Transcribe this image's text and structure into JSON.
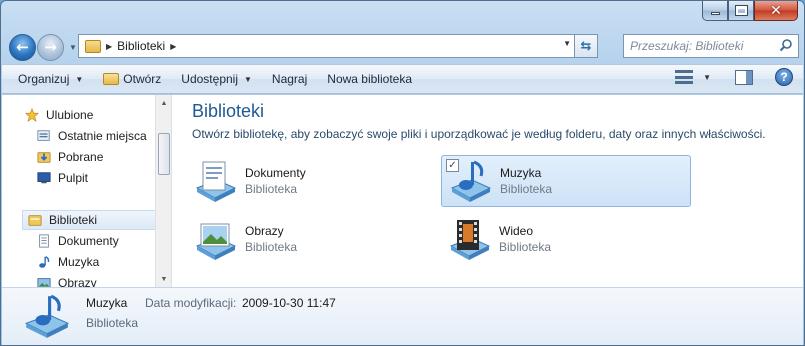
{
  "window": {
    "controls": {
      "minimize": "minimize",
      "maximize": "maximize",
      "close": "close"
    }
  },
  "navigation": {
    "address_path": "Biblioteki",
    "search_placeholder": "Przeszukaj: Biblioteki"
  },
  "toolbar": {
    "organize": "Organizuj",
    "open": "Otwórz",
    "share": "Udostępnij",
    "burn": "Nagraj",
    "new_library": "Nowa biblioteka"
  },
  "sidebar": {
    "favorites": "Ulubione",
    "recent": "Ostatnie miejsca",
    "downloads": "Pobrane",
    "desktop": "Pulpit",
    "libraries": "Biblioteki",
    "documents": "Dokumenty",
    "music": "Muzyka",
    "pictures": "Obrazy"
  },
  "main": {
    "title": "Biblioteki",
    "subtitle": "Otwórz bibliotekę, aby zobaczyć swoje pliki i uporządkować je według folderu, daty oraz innych właściwości.",
    "libraries": [
      {
        "name": "Dokumenty",
        "type": "Biblioteka",
        "selected": false
      },
      {
        "name": "Muzyka",
        "type": "Biblioteka",
        "selected": true
      },
      {
        "name": "Obrazy",
        "type": "Biblioteka",
        "selected": false
      },
      {
        "name": "Wideo",
        "type": "Biblioteka",
        "selected": false
      }
    ]
  },
  "details": {
    "name": "Muzyka",
    "modified_label": "Data modyfikacji:",
    "modified_value": "2009-10-30 11:47",
    "type": "Biblioteka"
  },
  "colors": {
    "title_blue": "#1e5a96",
    "selection": "#cde2f7",
    "frame": "#a9c9e8"
  }
}
